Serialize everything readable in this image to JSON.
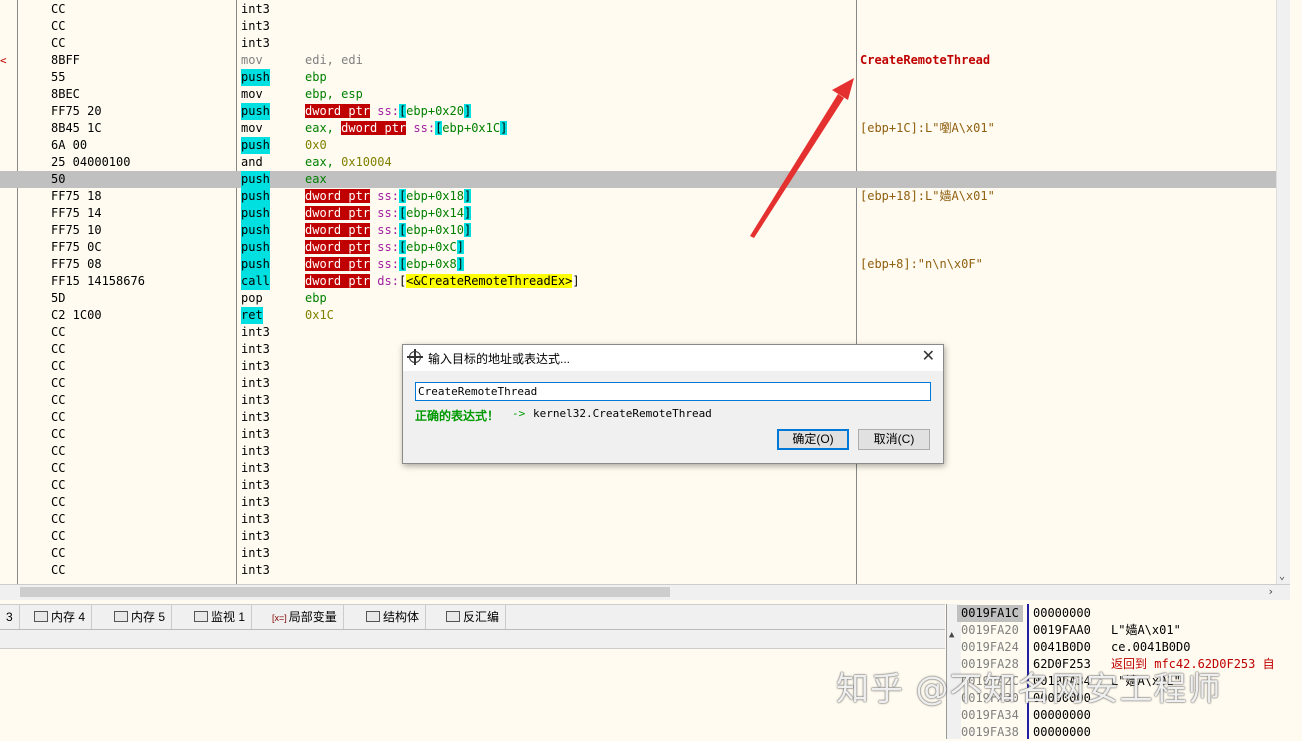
{
  "disassembly": {
    "rows": [
      {
        "marker": "",
        "bytes": "CC",
        "mnemonic": "int3",
        "mn_style": "",
        "ops": [],
        "comment": "",
        "selected": false
      },
      {
        "marker": "",
        "bytes": "CC",
        "mnemonic": "int3",
        "mn_style": "",
        "ops": [],
        "comment": "",
        "selected": false
      },
      {
        "marker": "",
        "bytes": "CC",
        "mnemonic": "int3",
        "mn_style": "",
        "ops": [],
        "comment": "",
        "selected": false
      },
      {
        "marker": "<",
        "bytes": "8BFF",
        "mnemonic": "mov",
        "mn_style": "c-gray",
        "ops": [
          {
            "t": "edi, edi",
            "s": "c-gray"
          }
        ],
        "comment": "CreateRemoteThread",
        "comment_style": "c-red",
        "selected": false
      },
      {
        "marker": "",
        "bytes": "55",
        "mnemonic": "push",
        "mn_style": "t-cyan",
        "ops": [
          {
            "t": "ebp",
            "s": "c-green"
          }
        ],
        "comment": "",
        "selected": false
      },
      {
        "marker": "",
        "bytes": "8BEC",
        "mnemonic": "mov",
        "mn_style": "",
        "ops": [
          {
            "t": "ebp, esp",
            "s": "c-green"
          }
        ],
        "comment": "",
        "selected": false
      },
      {
        "marker": "",
        "bytes": "FF75 20",
        "mnemonic": "push",
        "mn_style": "t-cyan",
        "ops": [
          {
            "t": "dword ptr",
            "s": "t-red"
          },
          {
            "t": " ss:",
            "s": "c-purple"
          },
          {
            "t": "[",
            "s": "t-cyan"
          },
          {
            "t": "ebp+0x20",
            "s": "c-green"
          },
          {
            "t": "]",
            "s": "t-cyan"
          }
        ],
        "comment": "",
        "selected": false
      },
      {
        "marker": "",
        "bytes": "8B45 1C",
        "mnemonic": "mov",
        "mn_style": "",
        "ops": [
          {
            "t": "eax, ",
            "s": "c-green"
          },
          {
            "t": "dword ptr",
            "s": "t-red"
          },
          {
            "t": " ss:",
            "s": "c-purple"
          },
          {
            "t": "[",
            "s": "t-cyan"
          },
          {
            "t": "ebp+0x1C",
            "s": "c-green"
          },
          {
            "t": "]",
            "s": "t-cyan"
          }
        ],
        "comment": "[ebp+1C]:L\"嚠A\\x01\"",
        "comment_style": "c-cm",
        "selected": false
      },
      {
        "marker": "",
        "bytes": "6A 00",
        "mnemonic": "push",
        "mn_style": "t-cyan",
        "ops": [
          {
            "t": "0x0",
            "s": "c-olive"
          }
        ],
        "comment": "",
        "selected": false
      },
      {
        "marker": "",
        "bytes": "25 04000100",
        "mnemonic": "and",
        "mn_style": "",
        "ops": [
          {
            "t": "eax, ",
            "s": "c-green"
          },
          {
            "t": "0x10004",
            "s": "c-olive"
          }
        ],
        "comment": "",
        "selected": false
      },
      {
        "marker": "",
        "bytes": "50",
        "mnemonic": "push",
        "mn_style": "t-cyan",
        "ops": [
          {
            "t": "eax",
            "s": "c-green"
          }
        ],
        "comment": "",
        "selected": true
      },
      {
        "marker": "",
        "bytes": "FF75 18",
        "mnemonic": "push",
        "mn_style": "t-cyan",
        "ops": [
          {
            "t": "dword ptr",
            "s": "t-red"
          },
          {
            "t": " ss:",
            "s": "c-purple"
          },
          {
            "t": "[",
            "s": "t-cyan"
          },
          {
            "t": "ebp+0x18",
            "s": "c-green"
          },
          {
            "t": "]",
            "s": "t-cyan"
          }
        ],
        "comment": "[ebp+18]:L\"嫱A\\x01\"",
        "comment_style": "c-cm",
        "selected": false
      },
      {
        "marker": "",
        "bytes": "FF75 14",
        "mnemonic": "push",
        "mn_style": "t-cyan",
        "ops": [
          {
            "t": "dword ptr",
            "s": "t-red"
          },
          {
            "t": " ss:",
            "s": "c-purple"
          },
          {
            "t": "[",
            "s": "t-cyan"
          },
          {
            "t": "ebp+0x14",
            "s": "c-green"
          },
          {
            "t": "]",
            "s": "t-cyan"
          }
        ],
        "comment": "",
        "selected": false
      },
      {
        "marker": "",
        "bytes": "FF75 10",
        "mnemonic": "push",
        "mn_style": "t-cyan",
        "ops": [
          {
            "t": "dword ptr",
            "s": "t-red"
          },
          {
            "t": " ss:",
            "s": "c-purple"
          },
          {
            "t": "[",
            "s": "t-cyan"
          },
          {
            "t": "ebp+0x10",
            "s": "c-green"
          },
          {
            "t": "]",
            "s": "t-cyan"
          }
        ],
        "comment": "",
        "selected": false
      },
      {
        "marker": "",
        "bytes": "FF75 0C",
        "mnemonic": "push",
        "mn_style": "t-cyan",
        "ops": [
          {
            "t": "dword ptr",
            "s": "t-red"
          },
          {
            "t": " ss:",
            "s": "c-purple"
          },
          {
            "t": "[",
            "s": "t-cyan"
          },
          {
            "t": "ebp+0xC",
            "s": "c-green"
          },
          {
            "t": "]",
            "s": "t-cyan"
          }
        ],
        "comment": "",
        "selected": false
      },
      {
        "marker": "",
        "bytes": "FF75 08",
        "mnemonic": "push",
        "mn_style": "t-cyan",
        "ops": [
          {
            "t": "dword ptr",
            "s": "t-red"
          },
          {
            "t": " ss:",
            "s": "c-purple"
          },
          {
            "t": "[",
            "s": "t-cyan"
          },
          {
            "t": "ebp+0x8",
            "s": "c-green"
          },
          {
            "t": "]",
            "s": "t-cyan"
          }
        ],
        "comment": "[ebp+8]:\"n\\n\\x0F\"",
        "comment_style": "c-cm",
        "selected": false
      },
      {
        "marker": "",
        "bytes": "FF15 14158676",
        "mnemonic": "call",
        "mn_style": "t-cyan",
        "ops": [
          {
            "t": "dword ptr",
            "s": "t-red"
          },
          {
            "t": " ds:",
            "s": "c-purple"
          },
          {
            "t": "[",
            "s": ""
          },
          {
            "t": "<&CreateRemoteThreadEx>",
            "s": "t-yel"
          },
          {
            "t": "]",
            "s": ""
          }
        ],
        "comment": "",
        "selected": false
      },
      {
        "marker": "",
        "bytes": "5D",
        "mnemonic": "pop",
        "mn_style": "",
        "ops": [
          {
            "t": "ebp",
            "s": "c-green"
          }
        ],
        "comment": "",
        "selected": false
      },
      {
        "marker": "",
        "bytes": "C2 1C00",
        "mnemonic": "ret",
        "mn_style": "t-cyan",
        "ops": [
          {
            "t": "0x1C",
            "s": "c-olive"
          }
        ],
        "comment": "",
        "selected": false
      },
      {
        "marker": "",
        "bytes": "CC",
        "mnemonic": "int3",
        "mn_style": "",
        "ops": [],
        "comment": "",
        "selected": false
      },
      {
        "marker": "",
        "bytes": "CC",
        "mnemonic": "int3",
        "mn_style": "",
        "ops": [],
        "comment": "",
        "selected": false
      },
      {
        "marker": "",
        "bytes": "CC",
        "mnemonic": "int3",
        "mn_style": "",
        "ops": [],
        "comment": "",
        "selected": false
      },
      {
        "marker": "",
        "bytes": "CC",
        "mnemonic": "int3",
        "mn_style": "",
        "ops": [],
        "comment": "",
        "selected": false
      },
      {
        "marker": "",
        "bytes": "CC",
        "mnemonic": "int3",
        "mn_style": "",
        "ops": [],
        "comment": "",
        "selected": false
      },
      {
        "marker": "",
        "bytes": "CC",
        "mnemonic": "int3",
        "mn_style": "",
        "ops": [],
        "comment": "",
        "selected": false
      },
      {
        "marker": "",
        "bytes": "CC",
        "mnemonic": "int3",
        "mn_style": "",
        "ops": [],
        "comment": "",
        "selected": false
      },
      {
        "marker": "",
        "bytes": "CC",
        "mnemonic": "int3",
        "mn_style": "",
        "ops": [],
        "comment": "",
        "selected": false
      },
      {
        "marker": "",
        "bytes": "CC",
        "mnemonic": "int3",
        "mn_style": "",
        "ops": [],
        "comment": "",
        "selected": false
      },
      {
        "marker": "",
        "bytes": "CC",
        "mnemonic": "int3",
        "mn_style": "",
        "ops": [],
        "comment": "",
        "selected": false
      },
      {
        "marker": "",
        "bytes": "CC",
        "mnemonic": "int3",
        "mn_style": "",
        "ops": [],
        "comment": "",
        "selected": false
      },
      {
        "marker": "",
        "bytes": "CC",
        "mnemonic": "int3",
        "mn_style": "",
        "ops": [],
        "comment": "",
        "selected": false
      },
      {
        "marker": "",
        "bytes": "CC",
        "mnemonic": "int3",
        "mn_style": "",
        "ops": [],
        "comment": "",
        "selected": false
      },
      {
        "marker": "",
        "bytes": "CC",
        "mnemonic": "int3",
        "mn_style": "",
        "ops": [],
        "comment": "",
        "selected": false
      },
      {
        "marker": "",
        "bytes": "CC",
        "mnemonic": "int3",
        "mn_style": "",
        "ops": [],
        "comment": "",
        "selected": false
      }
    ]
  },
  "tabs": [
    {
      "label": "3",
      "icon": ""
    },
    {
      "label": "内存 4",
      "icon": "memory-icon"
    },
    {
      "label": "内存 5",
      "icon": "memory-icon"
    },
    {
      "label": "监视 1",
      "icon": "watch-icon"
    },
    {
      "label": "局部变量",
      "icon": "locals-icon"
    },
    {
      "label": "结构体",
      "icon": "struct-icon"
    },
    {
      "label": "反汇编",
      "icon": "disasm-icon"
    }
  ],
  "locals_icon_text": "[x=]",
  "stack": {
    "rows": [
      {
        "addr": "0019FA1C",
        "value": "00000000",
        "comment": "",
        "current": true
      },
      {
        "addr": "0019FA20",
        "value": "0019FAA0",
        "comment": "L\"嫱A\\x01\"",
        "current": false
      },
      {
        "addr": "0019FA24",
        "value": "0041B0D0",
        "comment": "ce.0041B0D0",
        "current": false
      },
      {
        "addr": "0019FA28",
        "value": "62D0F253",
        "comment": "返回到 mfc42.62D0F253 自",
        "current": false,
        "red": true
      },
      {
        "addr": "0019FA2C",
        "value": "0019FA34",
        "comment": "L\"嫱A\\x01\"",
        "current": false
      },
      {
        "addr": "0019FA30",
        "value": "00000000",
        "comment": "",
        "current": false
      },
      {
        "addr": "0019FA34",
        "value": "00000000",
        "comment": "",
        "current": false
      },
      {
        "addr": "0019FA38",
        "value": "00000000",
        "comment": "",
        "current": false
      }
    ]
  },
  "watermark": "知乎 @不知名网安工程师",
  "dialog": {
    "title": "输入目标的地址或表达式...",
    "input_value": "CreateRemoteThread",
    "valid_label": "正确的表达式！",
    "arrow": "->",
    "resolved": "kernel32.CreateRemoteThread",
    "ok_label": "确定(O)",
    "cancel_label": "取消(C)"
  },
  "colors": {
    "background": "#fffbf0",
    "selection": "#c0c0c0",
    "annotation_arrow": "#e53030"
  }
}
